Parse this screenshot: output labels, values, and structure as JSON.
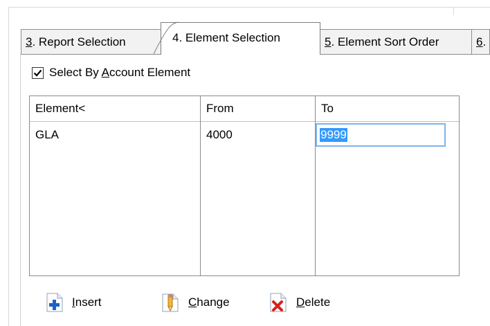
{
  "tabs": {
    "report_selection": {
      "hotkey": "3",
      "rest": ". Report Selection"
    },
    "element_selection": {
      "hotkey": "4",
      "rest": ". Element Selection"
    },
    "element_sort_order": {
      "hotkey": "5",
      "rest": ". Element Sort Order"
    },
    "next": {
      "hotkey": "6",
      "rest": "."
    }
  },
  "checkbox": {
    "label_pre": "Select By ",
    "label_hotkey": "A",
    "label_post": "ccount Element",
    "checked": true
  },
  "grid": {
    "columns": [
      "Element<",
      "From",
      "To"
    ],
    "rows": [
      {
        "element": "GLA",
        "from": "4000",
        "to": "9999"
      }
    ]
  },
  "buttons": {
    "insert": {
      "hotkey": "I",
      "rest": "nsert"
    },
    "change": {
      "hotkey": "C",
      "rest": "hange"
    },
    "delete": {
      "hotkey": "D",
      "rest": "elete"
    }
  },
  "colors": {
    "selection": "#3399ff",
    "focus_border": "#7eb4ea",
    "tab_bg": "#f2f2f2"
  }
}
